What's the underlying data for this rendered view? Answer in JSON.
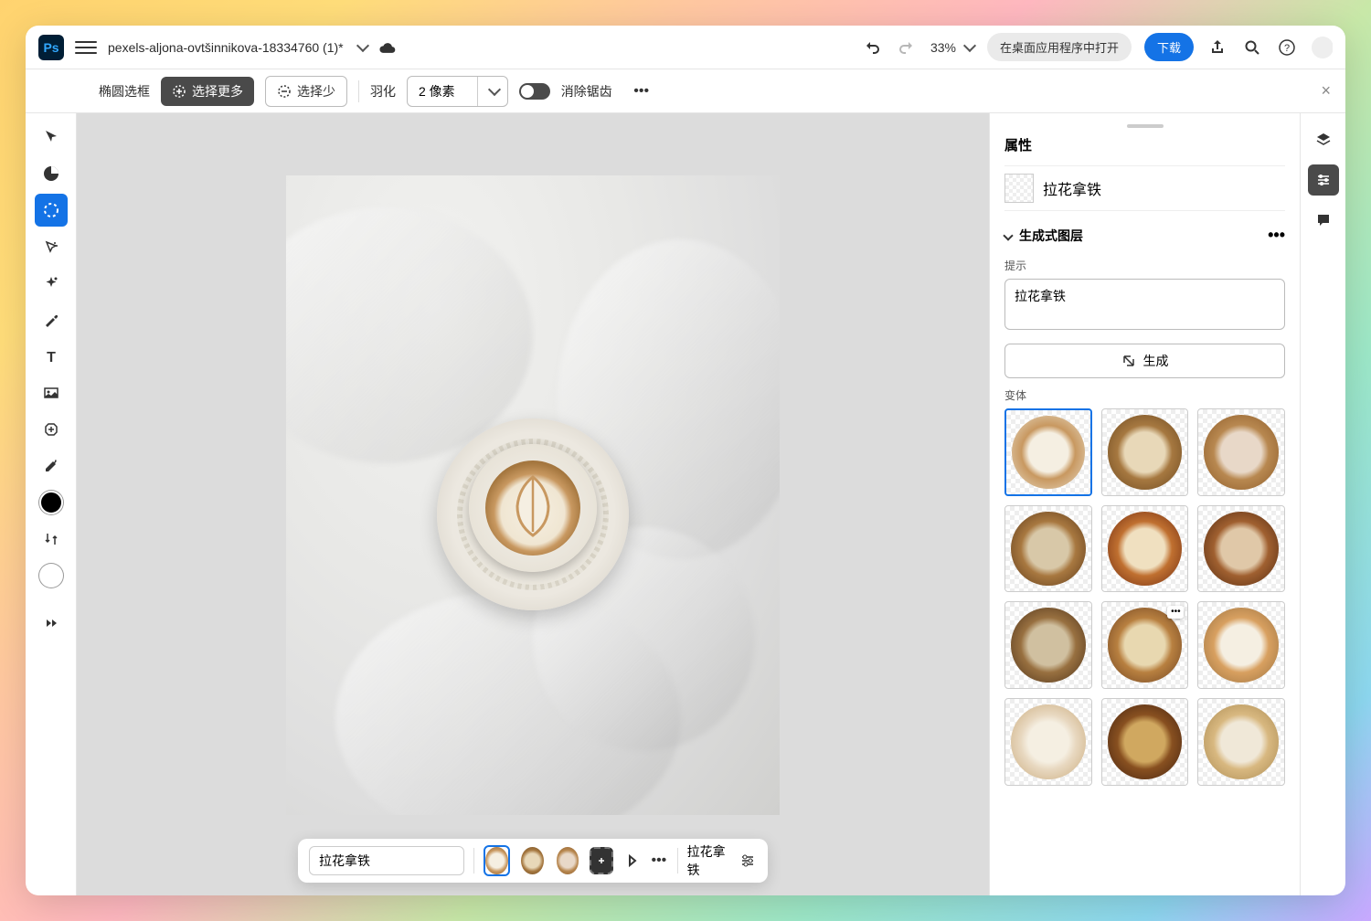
{
  "topbar": {
    "ps_logo": "Ps",
    "doc_title": "pexels-aljona-ovtšinnikova-18334760 (1)*",
    "zoom": "33%",
    "open_desktop": "在桌面应用程序中打开",
    "download": "下载"
  },
  "optbar": {
    "tool_name": "椭圆选框",
    "select_more": "选择更多",
    "select_less": "选择少",
    "feather_label": "羽化",
    "feather_value": "2 像素",
    "antialias": "消除锯齿"
  },
  "taskbar": {
    "prompt": "拉花拿铁",
    "label": "拉花拿铁"
  },
  "props": {
    "title": "属性",
    "layer_name": "拉花拿铁",
    "section": "生成式图层",
    "prompt_label": "提示",
    "prompt_value": "拉花拿铁",
    "generate": "生成",
    "variants_label": "变体"
  },
  "variant_colors": [
    {
      "inner": "#f5efe2",
      "ring": "#c89860",
      "outer": "#e8ddc8"
    },
    {
      "inner": "#e8d8b8",
      "ring": "#a67840",
      "outer": "#6b4820"
    },
    {
      "inner": "#e8d8c8",
      "ring": "#b88850",
      "outer": "#8b5a28"
    },
    {
      "inner": "#d8c8a8",
      "ring": "#a87840",
      "outer": "#5b3818"
    },
    {
      "inner": "#f0e0c0",
      "ring": "#c07030",
      "outer": "#6b2810"
    },
    {
      "inner": "#e0c8a8",
      "ring": "#a06030",
      "outer": "#502810"
    },
    {
      "inner": "#d0c0a0",
      "ring": "#987040",
      "outer": "#4b3018"
    },
    {
      "inner": "#e8d8b0",
      "ring": "#b88040",
      "outer": "#6b4020"
    },
    {
      "inner": "#f5efe2",
      "ring": "#d8a060",
      "outer": "#987040"
    },
    {
      "inner": "#f5efe2",
      "ring": "#e8d8c0",
      "outer": "#c8a878"
    },
    {
      "inner": "#d0a860",
      "ring": "#885020",
      "outer": "#402010"
    },
    {
      "inner": "#f0e8d8",
      "ring": "#d8b880",
      "outer": "#a88850"
    }
  ]
}
